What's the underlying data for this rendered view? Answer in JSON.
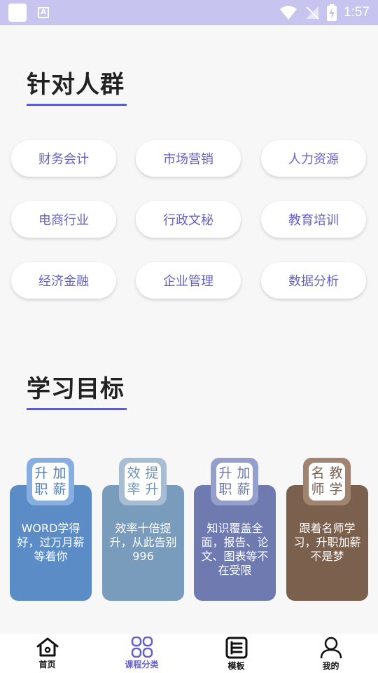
{
  "status_bar": {
    "time": "1:57"
  },
  "section1": {
    "title": "针对人群"
  },
  "chips": [
    "财务会计",
    "市场营销",
    "人力资源",
    "电商行业",
    "行政文秘",
    "教育培训",
    "经济金融",
    "企业管理",
    "数据分析"
  ],
  "section2": {
    "title": "学习目标"
  },
  "goals": [
    {
      "badge_line1": "升职",
      "badge_line2": "加薪",
      "text": "WORD学得好，过万月薪等着你",
      "color": "#5c8cc6",
      "badge_color": "#86aee0",
      "badge_text_color": "#4e7fc0"
    },
    {
      "badge_line1": "效率",
      "badge_line2": "提升",
      "text": "效率十倍提升，从此告别996",
      "color": "#7a9cbc",
      "badge_color": "#a6bdd4",
      "badge_text_color": "#6f93b6"
    },
    {
      "badge_line1": "升职",
      "badge_line2": "加薪",
      "text": "知识覆盖全面，报告、论文、图表等不在受限",
      "color": "#6f7bb0",
      "badge_color": "#959fcb",
      "badge_text_color": "#6b76ae"
    },
    {
      "badge_line1": "名师",
      "badge_line2": "教学",
      "text": "跟着名师学习，升职加薪不是梦",
      "color": "#7b604e",
      "badge_color": "#a08470",
      "badge_text_color": "#7b604e"
    }
  ],
  "nav": [
    {
      "label": "首页",
      "icon": "home-icon"
    },
    {
      "label": "课程分类",
      "icon": "grid-icon",
      "active": true
    },
    {
      "label": "模板",
      "icon": "template-icon"
    },
    {
      "label": "我的",
      "icon": "person-icon"
    }
  ],
  "colors": {
    "accent": "#6460c8",
    "status_bar": "#c8c4f0"
  }
}
